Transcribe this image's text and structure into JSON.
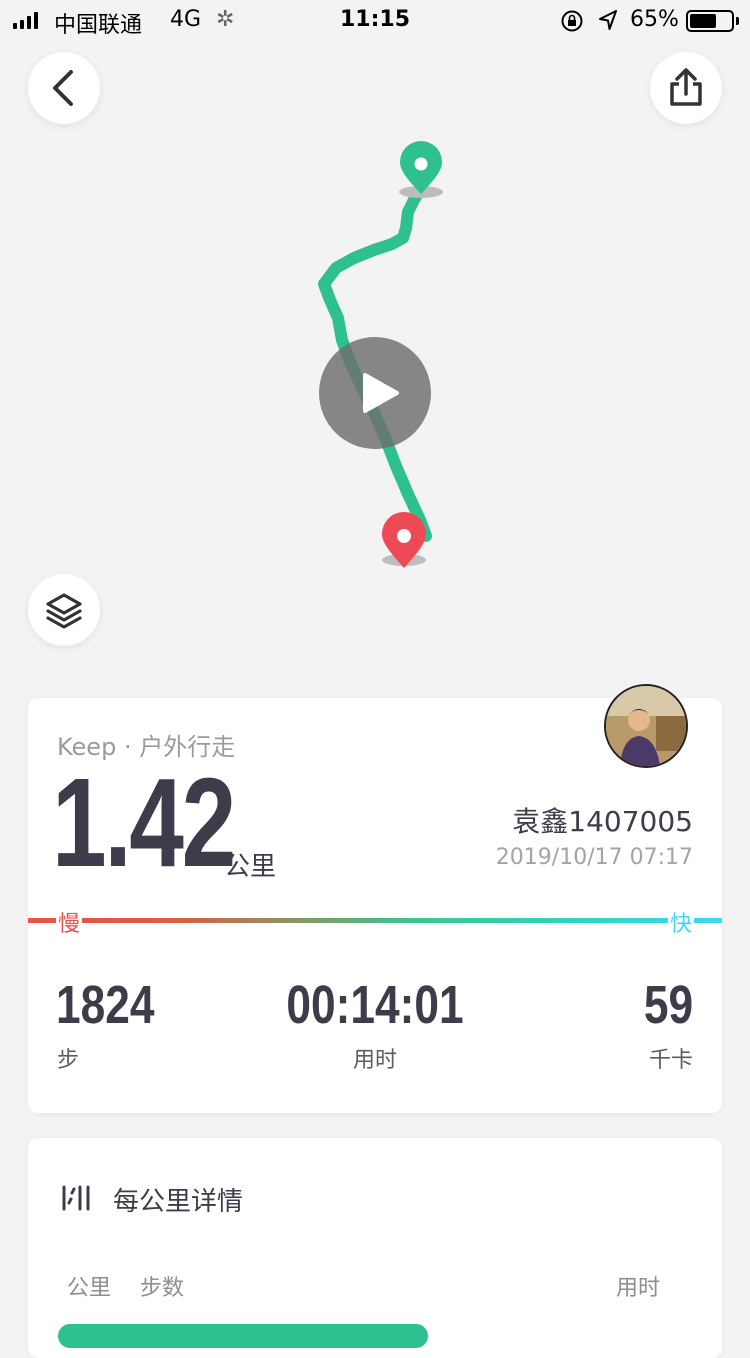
{
  "status_bar": {
    "carrier": "中国联通",
    "network": "4G",
    "time": "11:15",
    "battery_percent": "65%",
    "battery_level": 0.65
  },
  "map": {
    "route_color": "#2ec08e",
    "start_marker_color": "#2ec08e",
    "end_marker_color": "#ee4a55",
    "icons": [
      "back-arrow-icon",
      "share-icon",
      "play-icon",
      "layers-icon"
    ]
  },
  "summary": {
    "source": "Keep · 户外行走",
    "distance": "1.42",
    "distance_unit": "公里",
    "username": "袁鑫1407005",
    "datetime": "2019/10/17 07:17",
    "pace_slow_label": "慢",
    "pace_fast_label": "快",
    "stats": [
      {
        "value": "1824",
        "label": "步"
      },
      {
        "value": "00:14:01",
        "label": "用时"
      },
      {
        "value": "59",
        "label": "千卡"
      }
    ]
  },
  "detail": {
    "title": "每公里详情",
    "columns": {
      "km": "公里",
      "steps": "步数",
      "time": "用时"
    }
  }
}
